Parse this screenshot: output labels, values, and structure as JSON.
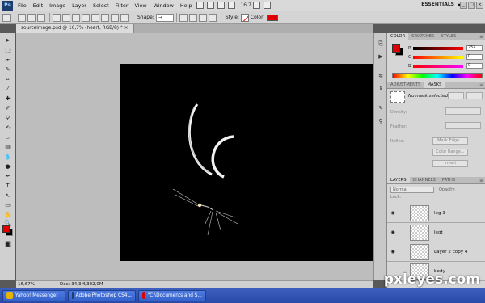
{
  "menubar": {
    "logo": "Ps",
    "items": [
      "File",
      "Edit",
      "Image",
      "Layer",
      "Select",
      "Filter",
      "View",
      "Window",
      "Help"
    ],
    "zoom": "16.7",
    "workspace": "ESSENTIALS"
  },
  "options": {
    "shape_label": "Shape:",
    "style_label": "Style:",
    "color_label": "Color:",
    "color_value": "#e00000"
  },
  "document": {
    "tab_title": "sourceimage.psd @ 16,7% (heart, RGB/8) *",
    "canvas_color": "#000000"
  },
  "statusbar": {
    "zoom": "16,67%",
    "doc_info": "Doc: 34,3M/302,0M"
  },
  "color_panel": {
    "tabs": [
      "COLOR",
      "SWATCHES",
      "STYLES"
    ],
    "r_label": "R",
    "g_label": "G",
    "b_label": "B",
    "r_value": "255",
    "g_value": "0",
    "b_value": "0",
    "foreground": "#e00000",
    "background": "#000000"
  },
  "masks_panel": {
    "tabs": [
      "ADJUSTMENTS",
      "MASKS"
    ],
    "status": "No mask selected",
    "density_label": "Density:",
    "feather_label": "Feather:",
    "refine_label": "Refine:",
    "buttons": [
      "Mask Edge...",
      "Color Range...",
      "Invert"
    ]
  },
  "layers_panel": {
    "tabs": [
      "LAYERS",
      "CHANNELS",
      "PATHS"
    ],
    "blend_mode": "Normal",
    "opacity_label": "Opacity:",
    "lock_label": "Lock:",
    "layers": [
      {
        "name": "leg 3",
        "visible": true
      },
      {
        "name": "legt",
        "visible": true
      },
      {
        "name": "Layer 2 copy 4",
        "visible": true
      },
      {
        "name": "body",
        "visible": false
      }
    ]
  },
  "taskbar": {
    "items": [
      {
        "label": "Yahoo! Messenger",
        "icon_color": "#e8b400"
      },
      {
        "label": "Adobe Photoshop CS4...",
        "icon_color": "#1c3d6e"
      },
      {
        "label": "\"C:\\Documents and S...",
        "icon_color": "#e00000"
      }
    ]
  },
  "watermark": "pxleyes.com"
}
